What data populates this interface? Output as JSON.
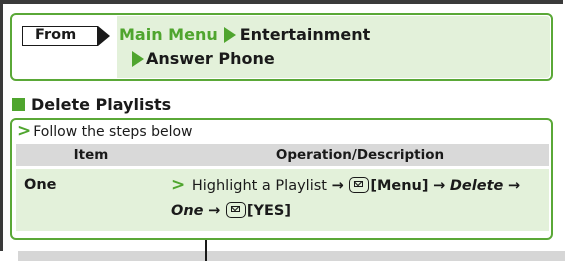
{
  "from": {
    "label": "From",
    "path": [
      "Main Menu",
      "Entertainment",
      "Answer Phone"
    ]
  },
  "section": {
    "title": "Delete Playlists"
  },
  "steps": {
    "intro": "Follow the steps below",
    "columns": [
      "Item",
      "Operation/Description"
    ],
    "rows": [
      {
        "item": "One",
        "op": {
          "t1": "Highlight a Playlist",
          "k1": "[Menu]",
          "t2": "Delete",
          "t3": "One",
          "k2": "[YES]"
        }
      }
    ]
  },
  "colors": {
    "accent_green": "#4fa52e",
    "light_green": "#e3f1da",
    "header_gray": "#d9d9d9"
  },
  "icons": [
    "mail-key-icon",
    "right-arrow-icon",
    "triangle-bullet-icon"
  ]
}
